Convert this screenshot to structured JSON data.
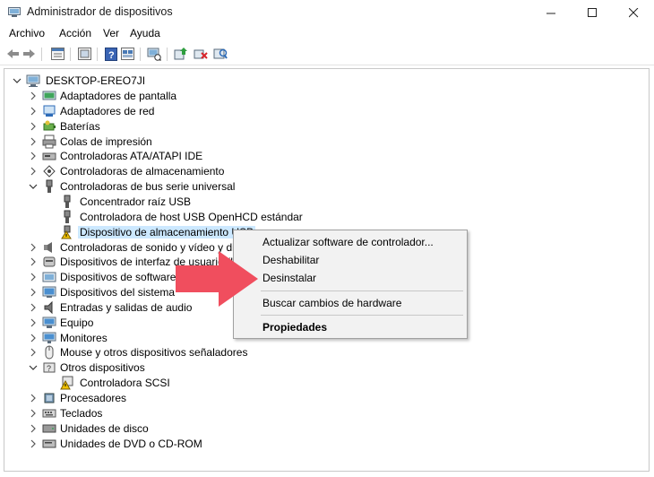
{
  "window": {
    "title": "Administrador de dispositivos",
    "controls": [
      "minimize",
      "maximize",
      "close"
    ]
  },
  "menu": {
    "items": [
      "Archivo",
      "Acción",
      "Ver",
      "Ayuda"
    ]
  },
  "toolbar": {
    "buttons": [
      "back-icon",
      "forward-icon",
      "properties-icon",
      "show-hide-icon",
      "help-icon",
      "view-icon",
      "monitor-icon",
      "update-driver-icon",
      "uninstall-icon",
      "scan-icon"
    ]
  },
  "tree": {
    "root": "DESKTOP-EREO7JI",
    "items": [
      {
        "label": "Adaptadores de pantalla",
        "icon": "display-adapter-icon"
      },
      {
        "label": "Adaptadores de red",
        "icon": "network-adapter-icon"
      },
      {
        "label": "Baterías",
        "icon": "battery-icon"
      },
      {
        "label": "Colas de impresión",
        "icon": "printer-icon"
      },
      {
        "label": "Controladoras ATA/ATAPI IDE",
        "icon": "ide-icon"
      },
      {
        "label": "Controladoras de almacenamiento",
        "icon": "storage-controller-icon"
      },
      {
        "label": "Controladoras de bus serie universal",
        "icon": "usb-icon"
      },
      {
        "label": "Concentrador raíz USB",
        "icon": "usb-icon"
      },
      {
        "label": "Controladora de host USB OpenHCD estándar",
        "icon": "usb-icon"
      },
      {
        "label": "Dispositivo de almacenamiento USB",
        "icon": "warning-usb-icon"
      },
      {
        "label": "Controladoras de sonido y vídeo y dispo",
        "icon": "sound-icon"
      },
      {
        "label": "Dispositivos de interfaz de usuario (HID",
        "icon": "hid-icon"
      },
      {
        "label": "Dispositivos de software",
        "icon": "software-device-icon"
      },
      {
        "label": "Dispositivos del sistema",
        "icon": "system-device-icon"
      },
      {
        "label": "Entradas y salidas de audio",
        "icon": "audio-icon"
      },
      {
        "label": "Equipo",
        "icon": "computer-icon"
      },
      {
        "label": "Monitores",
        "icon": "monitor-icon"
      },
      {
        "label": "Mouse y otros dispositivos señaladores",
        "icon": "mouse-icon"
      },
      {
        "label": "Otros dispositivos",
        "icon": "unknown-device-icon"
      },
      {
        "label": "Controladora SCSI",
        "icon": "warning-device-icon"
      },
      {
        "label": "Procesadores",
        "icon": "processor-icon"
      },
      {
        "label": "Teclados",
        "icon": "keyboard-icon"
      },
      {
        "label": "Unidades de disco",
        "icon": "disk-icon"
      },
      {
        "label": "Unidades de DVD o CD-ROM",
        "icon": "dvd-icon"
      }
    ]
  },
  "context_menu": {
    "items": [
      "Actualizar software de controlador...",
      "Deshabilitar",
      "Desinstalar",
      "Buscar cambios de hardware",
      "Propiedades"
    ]
  },
  "colors": {
    "selection": "#cce8ff",
    "arrow": "#f04e5e",
    "menu_bg": "#f2f2f2"
  }
}
